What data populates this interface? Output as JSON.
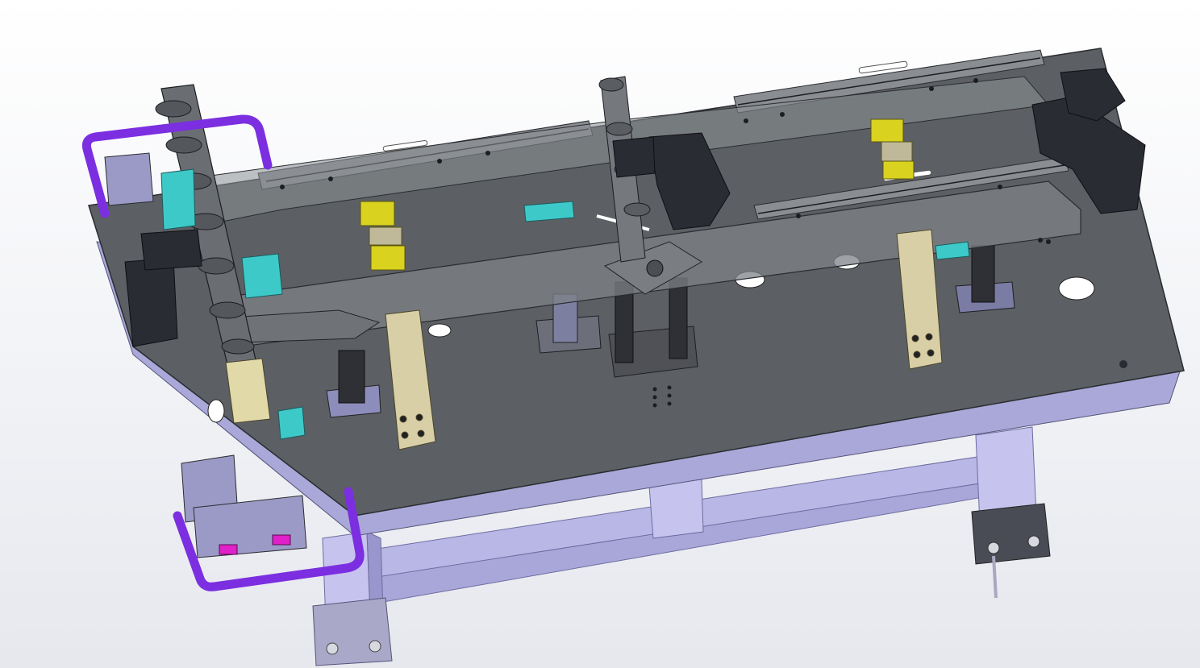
{
  "scene": {
    "description_visible_text": "",
    "colors": {
      "background_top": "#ffffff",
      "background_bottom": "#e6e8ee",
      "table_plate": "#5c5f63",
      "table_plate_edge": "#3a3c40",
      "frame_lavender": "#b9b7e6",
      "frame_lavender_dark": "#8e8cc4",
      "handle_purple": "#7b2fe0",
      "clamp_yellow": "#d9d21f",
      "support_beige": "#d8cfa6",
      "sensor_cyan": "#3ec9c9",
      "pin_magenta": "#e020c8",
      "dark_parts": "#2a2c33",
      "rail_grey": "#8a8d92"
    },
    "icons": [
      "fixture-table",
      "lavender-frame",
      "purple-handle",
      "yellow-clamp",
      "beige-support",
      "rail",
      "bracket",
      "hole"
    ]
  }
}
